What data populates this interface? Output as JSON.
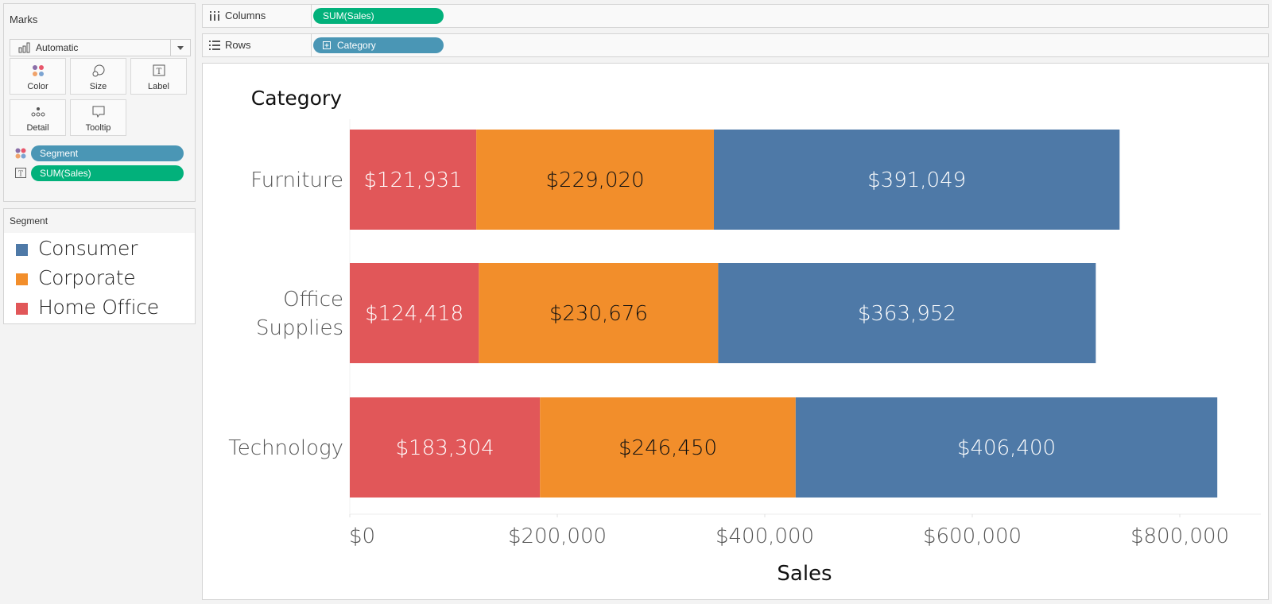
{
  "marks": {
    "title": "Marks",
    "mark_type": "Automatic",
    "buttons": [
      {
        "id": "color",
        "label": "Color",
        "icon": "color-dots-icon"
      },
      {
        "id": "size",
        "label": "Size",
        "icon": "size-circles-icon"
      },
      {
        "id": "label",
        "label": "Label",
        "icon": "text-label-icon"
      },
      {
        "id": "detail",
        "label": "Detail",
        "icon": "detail-dots-icon"
      },
      {
        "id": "tooltip",
        "label": "Tooltip",
        "icon": "tooltip-bubble-icon"
      }
    ],
    "pills": [
      {
        "label": "Segment",
        "type": "color",
        "color": "#4a96b5"
      },
      {
        "label": "SUM(Sales)",
        "type": "label",
        "color": "#02b17b"
      }
    ]
  },
  "legend": {
    "title": "Segment",
    "items": [
      {
        "label": "Consumer",
        "color": "#4e79a7"
      },
      {
        "label": "Corporate",
        "color": "#f28e2b"
      },
      {
        "label": "Home Office",
        "color": "#e15759"
      }
    ]
  },
  "shelves": {
    "columns": {
      "label": "Columns",
      "pill": "SUM(Sales)",
      "pill_color": "#02b17b"
    },
    "rows": {
      "label": "Rows",
      "pill": "Category",
      "pill_color": "#4a96b5"
    }
  },
  "chart_data": {
    "type": "bar",
    "orientation": "horizontal",
    "stacked": true,
    "row_header": "Category",
    "categories": [
      "Furniture",
      "Office Supplies",
      "Technology"
    ],
    "category_display": [
      [
        "Furniture"
      ],
      [
        "Office",
        "Supplies"
      ],
      [
        "Technology"
      ]
    ],
    "series": [
      {
        "name": "Home Office",
        "color": "#e15759",
        "label_color": "#ffffff",
        "values": [
          121931,
          124418,
          183304
        ],
        "labels": [
          "$121,931",
          "$124,418",
          "$183,304"
        ]
      },
      {
        "name": "Corporate",
        "color": "#f28e2b",
        "label_color": "#111111",
        "values": [
          229020,
          230676,
          246450
        ],
        "labels": [
          "$229,020",
          "$230,676",
          "$246,450"
        ]
      },
      {
        "name": "Consumer",
        "color": "#4e79a7",
        "label_color": "#ffffff",
        "values": [
          391049,
          363952,
          406400
        ],
        "labels": [
          "$391,049",
          "$363,952",
          "$406,400"
        ]
      }
    ],
    "xlabel": "Sales",
    "ylabel": "Category",
    "xlim": [
      0,
      880000
    ],
    "xticks": [
      0,
      200000,
      400000,
      600000,
      800000
    ],
    "xtick_labels": [
      "$0",
      "$200,000",
      "$400,000",
      "$600,000",
      "$800,000"
    ],
    "legend": "left-panel",
    "grid": false
  }
}
